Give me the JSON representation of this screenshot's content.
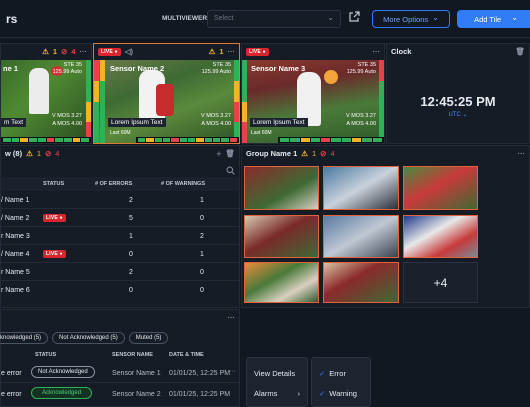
{
  "header": {
    "title": "rs",
    "multiviewer_label": "MULTIVIEWER:",
    "select_placeholder": "Select",
    "more_options": "More Options",
    "add_tile": "Add Tile"
  },
  "tiles": [
    {
      "name": "ne 1",
      "warn": "1",
      "err": "4",
      "ste": "STE 35",
      "res": "125.99 Auto",
      "mos1": "V MOS 3.27",
      "mos2": "A MOS 4.00",
      "caption": "m Text",
      "footer": ""
    },
    {
      "name": "Sensor Name 2",
      "live": "LIVE",
      "warn": "1",
      "ste": "STE 35",
      "res": "125.99 Auto",
      "mos1": "V MOS 3.27",
      "mos2": "A MOS 4.00",
      "caption": "Lorem Ipsum Text",
      "footer": "Last 60M"
    },
    {
      "name": "Sensor Name 3",
      "live": "LIVE",
      "ste": "STE 35",
      "res": "125.99 Auto",
      "mos1": "V MOS 3.27",
      "mos2": "A MOS 4.00",
      "caption": "Lorem Ipsum Text",
      "footer": "Last 60M"
    }
  ],
  "clock": {
    "title": "Clock",
    "time": "12:45:25 PM",
    "tz": "UTC"
  },
  "table_panel": {
    "title": "w (8)",
    "warn": "1",
    "err": "4",
    "columns": [
      "STATUS",
      "# OF ERRORS",
      "# OF WARNINGS"
    ],
    "rows": [
      {
        "name": "/ Name 1",
        "status": "",
        "errors": "2",
        "warnings": "1"
      },
      {
        "name": "/ Name 2",
        "status": "LIVE",
        "errors": "5",
        "warnings": "0"
      },
      {
        "name": "r Name 3",
        "status": "",
        "errors": "1",
        "warnings": "2"
      },
      {
        "name": "/ Name 4",
        "status": "LIVE",
        "errors": "0",
        "warnings": "1"
      },
      {
        "name": "r Name 5",
        "status": "",
        "errors": "2",
        "warnings": "0"
      },
      {
        "name": "r Name 6",
        "status": "",
        "errors": "0",
        "warnings": "0"
      }
    ]
  },
  "group": {
    "title": "Group Name 1",
    "warn": "1",
    "err": "4",
    "more": "+4"
  },
  "alarms": {
    "filters": [
      "knowledged (5)",
      "Not Acknowledged (5)",
      "Muted (5)"
    ],
    "columns": [
      "STATUS",
      "SENSOR NAME",
      "DATE & TIME"
    ],
    "rows": [
      {
        "type": "e error",
        "status": "Not Acknowledged",
        "sensor": "Sensor Name 1",
        "date": "01/01/25, 12:25 PM"
      },
      {
        "type": "e error",
        "status": "Acknowledged",
        "sensor": "Sensor Name 2",
        "date": "01/01/25, 12:25 PM"
      }
    ]
  },
  "menu": {
    "view_details": "View Details",
    "alarms": "Alarms",
    "error": "Error",
    "warning": "Warning"
  },
  "colors": {
    "accent": "#2f7cf6",
    "live": "#d8262e",
    "warn": "#f0b428",
    "error": "#e8414a",
    "ack": "#2fb15a",
    "tile_border": "#e07a2e"
  }
}
